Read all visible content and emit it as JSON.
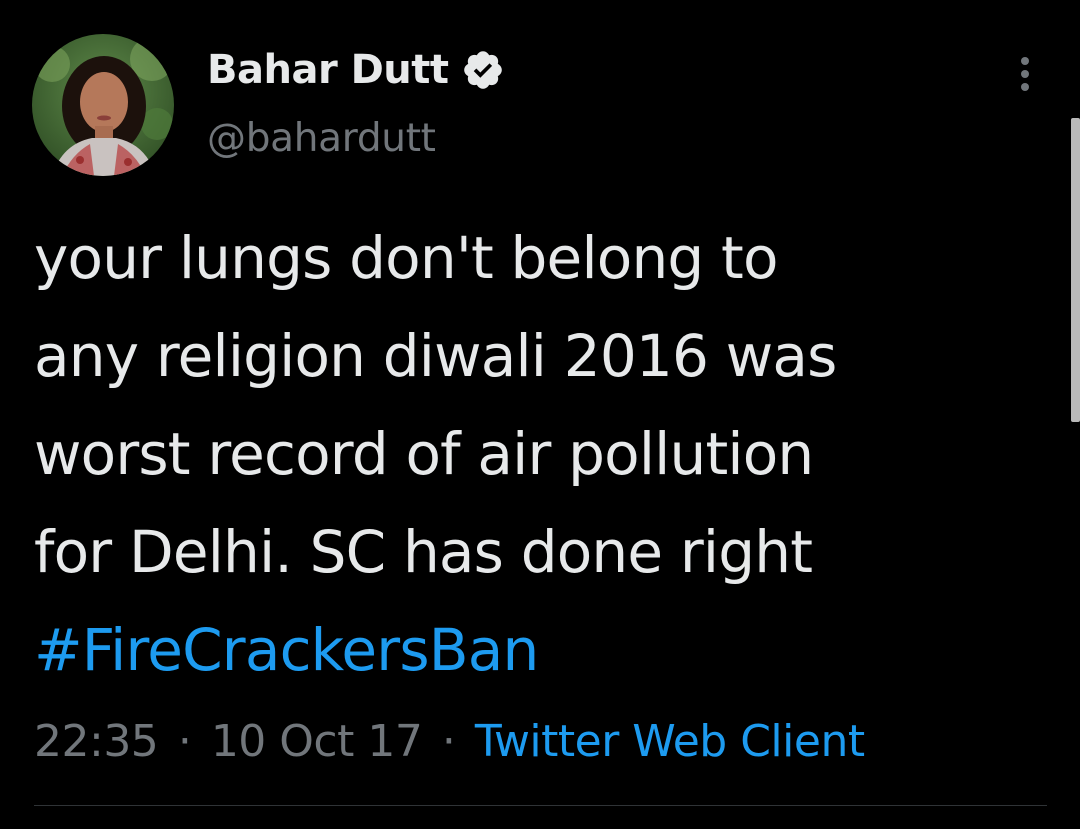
{
  "author": {
    "display_name": "Bahar Dutt",
    "handle": "@bahardutt",
    "verified": true
  },
  "menu": {
    "icon": "more-vertical-icon"
  },
  "tweet": {
    "lines": [
      "your lungs don't belong to",
      "any religion diwali 2016 was",
      "worst record of air pollution",
      "for Delhi. SC has done right"
    ],
    "hashtag": "#FireCrackersBan"
  },
  "meta": {
    "time": "22:35",
    "date": "10 Oct 17",
    "separator": "·",
    "client": "Twitter Web Client"
  },
  "colors": {
    "background": "#000000",
    "text": "#e7e9ea",
    "secondary": "#71767b",
    "accent": "#1d9bf0"
  }
}
